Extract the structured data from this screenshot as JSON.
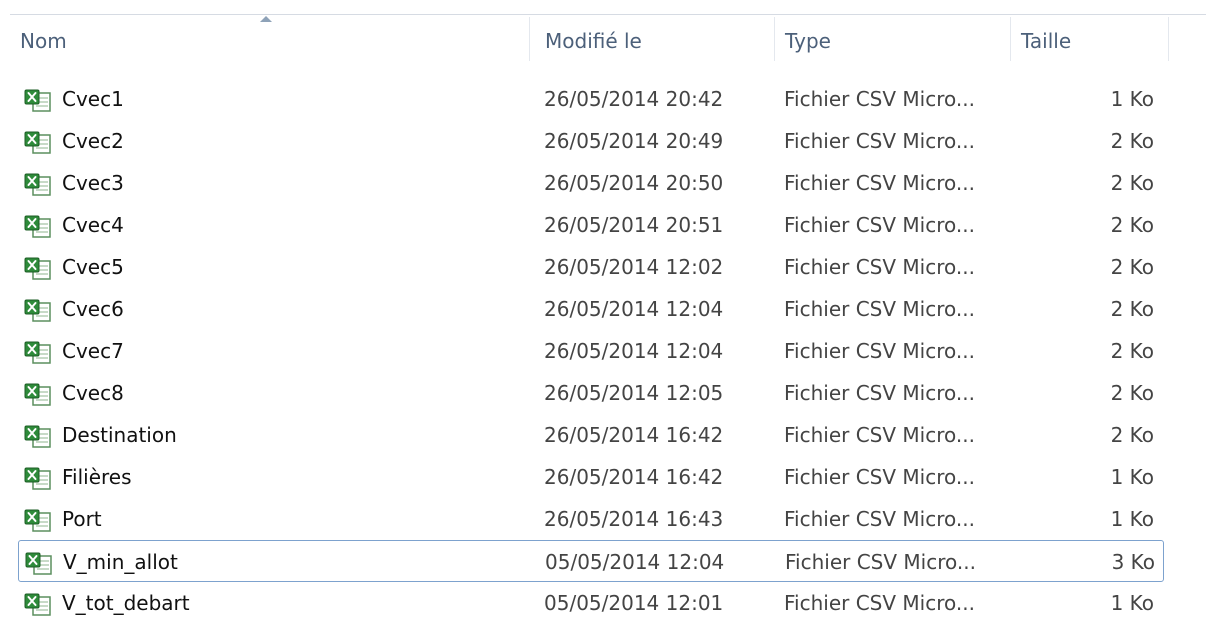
{
  "columns": {
    "name": "Nom",
    "modified": "Modifié le",
    "type": "Type",
    "size": "Taille"
  },
  "sort_indicator": "sort-ascending-arrow",
  "icon": "excel-csv-file-icon",
  "colors": {
    "header_text": "#4c607a",
    "selection_border": "#7da2ce",
    "icon_green": "#2e8b3a"
  },
  "files": [
    {
      "name": "Cvec1",
      "modified": "26/05/2014 20:42",
      "type": "Fichier CSV Micro...",
      "size": "1 Ko"
    },
    {
      "name": "Cvec2",
      "modified": "26/05/2014 20:49",
      "type": "Fichier CSV Micro...",
      "size": "2 Ko"
    },
    {
      "name": "Cvec3",
      "modified": "26/05/2014 20:50",
      "type": "Fichier CSV Micro...",
      "size": "2 Ko"
    },
    {
      "name": "Cvec4",
      "modified": "26/05/2014 20:51",
      "type": "Fichier CSV Micro...",
      "size": "2 Ko"
    },
    {
      "name": "Cvec5",
      "modified": "26/05/2014 12:02",
      "type": "Fichier CSV Micro...",
      "size": "2 Ko"
    },
    {
      "name": "Cvec6",
      "modified": "26/05/2014 12:04",
      "type": "Fichier CSV Micro...",
      "size": "2 Ko"
    },
    {
      "name": "Cvec7",
      "modified": "26/05/2014 12:04",
      "type": "Fichier CSV Micro...",
      "size": "2 Ko"
    },
    {
      "name": "Cvec8",
      "modified": "26/05/2014 12:05",
      "type": "Fichier CSV Micro...",
      "size": "2 Ko"
    },
    {
      "name": "Destination",
      "modified": "26/05/2014 16:42",
      "type": "Fichier CSV Micro...",
      "size": "2 Ko"
    },
    {
      "name": "Filières",
      "modified": "26/05/2014 16:42",
      "type": "Fichier CSV Micro...",
      "size": "1 Ko"
    },
    {
      "name": "Port",
      "modified": "26/05/2014 16:43",
      "type": "Fichier CSV Micro...",
      "size": "1 Ko"
    },
    {
      "name": "V_min_allot",
      "modified": "05/05/2014 12:04",
      "type": "Fichier CSV Micro...",
      "size": "3 Ko",
      "selected": true
    },
    {
      "name": "V_tot_debart",
      "modified": "05/05/2014 12:01",
      "type": "Fichier CSV Micro...",
      "size": "1 Ko"
    }
  ]
}
